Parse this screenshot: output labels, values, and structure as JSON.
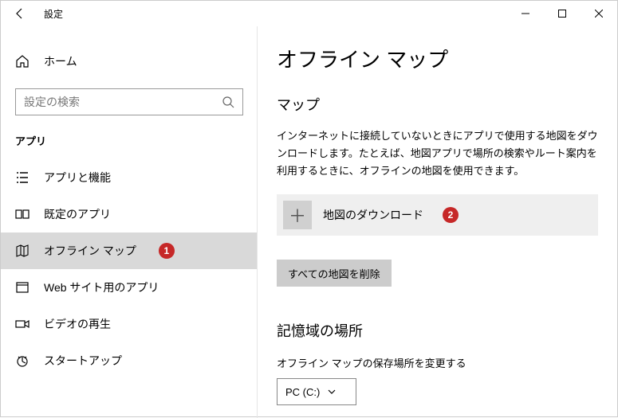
{
  "titlebar": {
    "title": "設定"
  },
  "sidebar": {
    "home_label": "ホーム",
    "search_placeholder": "設定の検索",
    "section_label": "アプリ",
    "items": [
      {
        "label": "アプリと機能",
        "icon": "list-icon"
      },
      {
        "label": "既定のアプリ",
        "icon": "defaults-icon"
      },
      {
        "label": "オフライン マップ",
        "icon": "map-icon",
        "badge": "1"
      },
      {
        "label": "Web サイト用のアプリ",
        "icon": "web-apps-icon"
      },
      {
        "label": "ビデオの再生",
        "icon": "video-icon"
      },
      {
        "label": "スタートアップ",
        "icon": "startup-icon"
      }
    ]
  },
  "main": {
    "heading": "オフライン マップ",
    "section_maps": "マップ",
    "description": "インターネットに接続していないときにアプリで使用する地図をダウンロードします。たとえば、地図アプリで場所の検索やルート案内を利用するときに、オフラインの地図を使用できます。",
    "download_label": "地図のダウンロード",
    "download_badge": "2",
    "delete_all_label": "すべての地図を削除",
    "section_storage": "記憶域の場所",
    "storage_sub": "オフライン マップの保存場所を変更する",
    "storage_value": "PC (C:)"
  }
}
